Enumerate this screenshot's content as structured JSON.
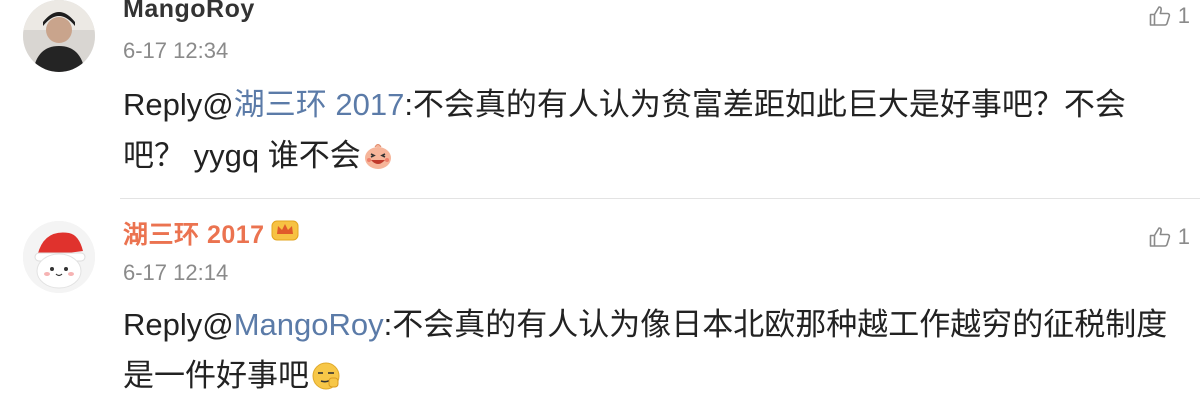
{
  "comments": [
    {
      "username": "MangoRoy",
      "time": "6-17 12:34",
      "likes": "1",
      "reply_prefix": "Reply@",
      "reply_to": "湖三环 2017",
      "text": ":不会真的有人认为贫富差距如此巨大是好事吧？不会吧？ yygq 谁不会",
      "emoji": "laughing-emoji-icon"
    },
    {
      "username": "湖三环 2017",
      "time": "6-17 12:14",
      "likes": "1",
      "reply_prefix": "Reply@",
      "reply_to": "MangoRoy",
      "text": ":不会真的有人认为像日本北欧那种越工作越穷的征税制度是一件好事吧",
      "emoji": "smirk-emoji-icon"
    }
  ],
  "colors": {
    "mention": "#5b7ba8",
    "vip_username": "#eb7350",
    "meta": "#8a8a8a"
  }
}
